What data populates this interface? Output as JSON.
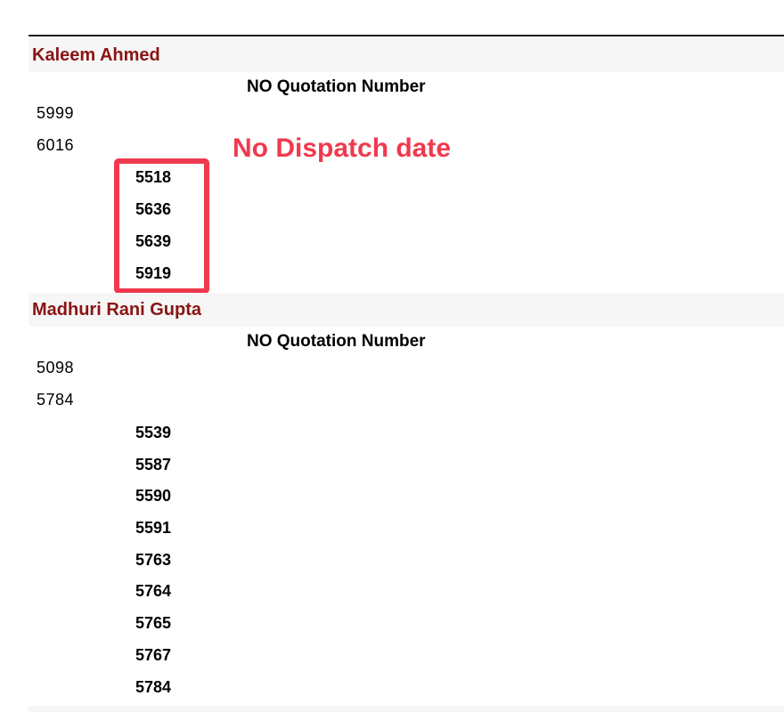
{
  "groups": [
    {
      "name": "Kaleem Ahmed",
      "column_heading": "NO Quotation Number",
      "numbers": [
        "5999",
        "6016"
      ],
      "sub_numbers": [
        "5518",
        "5636",
        "5639",
        "5919"
      ]
    },
    {
      "name": "Madhuri Rani Gupta",
      "column_heading": "NO Quotation Number",
      "numbers": [
        "5098",
        "5784"
      ],
      "sub_numbers": [
        "5539",
        "5587",
        "5590",
        "5591",
        "5763",
        "5764",
        "5765",
        "5767",
        "5784"
      ]
    }
  ],
  "annotation": {
    "label": "No Dispatch date",
    "color": "#f0394e"
  },
  "colors": {
    "group_header_text": "#8a1414",
    "group_header_bg": "#f6f6f6"
  }
}
